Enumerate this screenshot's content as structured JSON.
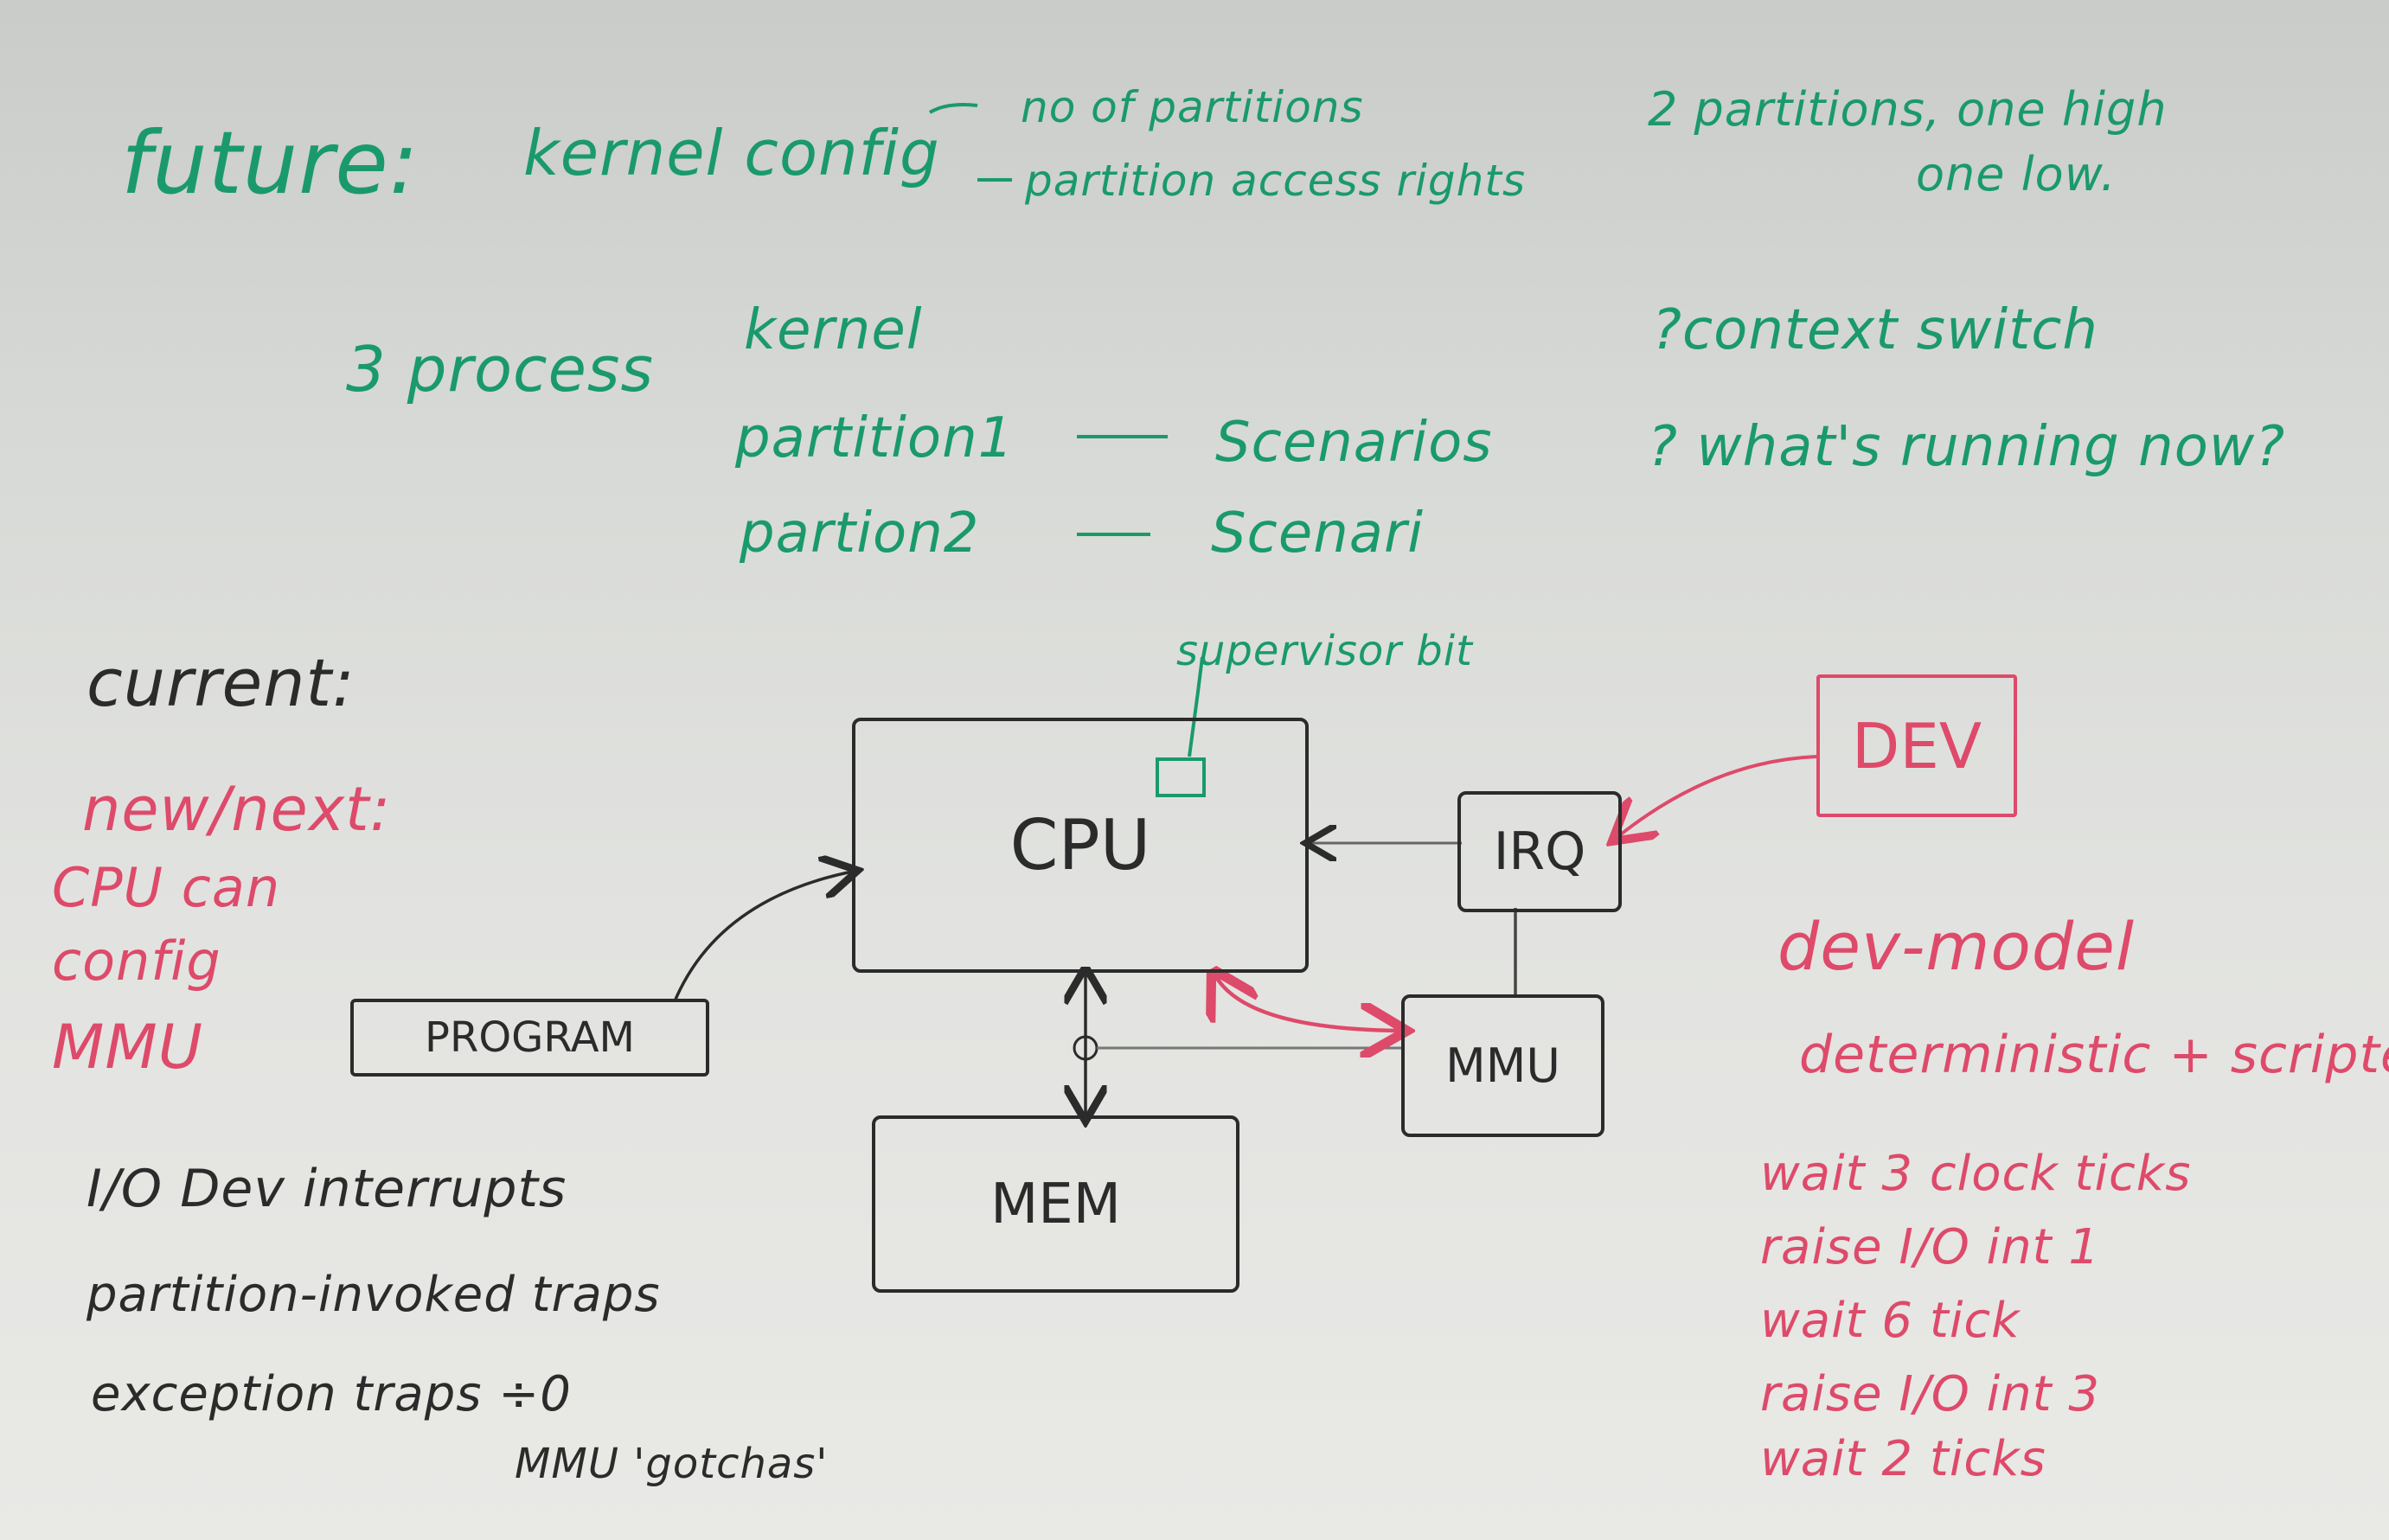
{
  "future": {
    "heading": "future:",
    "kernel_config": "kernel config",
    "config_items": [
      "no of partitions",
      "partition access rights"
    ],
    "note_line1": "2 partitions, one high",
    "note_line2": "one low."
  },
  "processes": {
    "label": "3 process",
    "items": [
      {
        "name": "kernel",
        "scenario": ""
      },
      {
        "name": "partition1",
        "scenario": "Scenarios"
      },
      {
        "name": "partion2",
        "scenario": "Scenari"
      }
    ],
    "dash": "—"
  },
  "questions": [
    "?context switch",
    "? what's running now?"
  ],
  "current": {
    "heading": "current:",
    "new_next": "new/next:",
    "cpu_note": [
      "CPU can",
      "config",
      "MMU"
    ],
    "list": [
      "I/O Dev interrupts",
      "partition-invoked traps",
      "exception traps ÷0",
      "MMU 'gotchas'"
    ]
  },
  "diagram": {
    "cpu": "CPU",
    "supervisor_bit": "supervisor bit",
    "irq": "IRQ",
    "mmu": "MMU",
    "mem": "MEM",
    "program": "PROGRAM",
    "dev": "DEV"
  },
  "dev_model": {
    "title": "dev-model",
    "subtitle": "deterministic + scripted",
    "steps": [
      "wait 3 clock ticks",
      "raise I/O int 1",
      "wait 6 tick",
      "raise I/O int 3",
      "wait 2 ticks"
    ]
  },
  "colors": {
    "green": "#1a9a6c",
    "red": "#de4a6a",
    "black": "#2b2b2b"
  }
}
